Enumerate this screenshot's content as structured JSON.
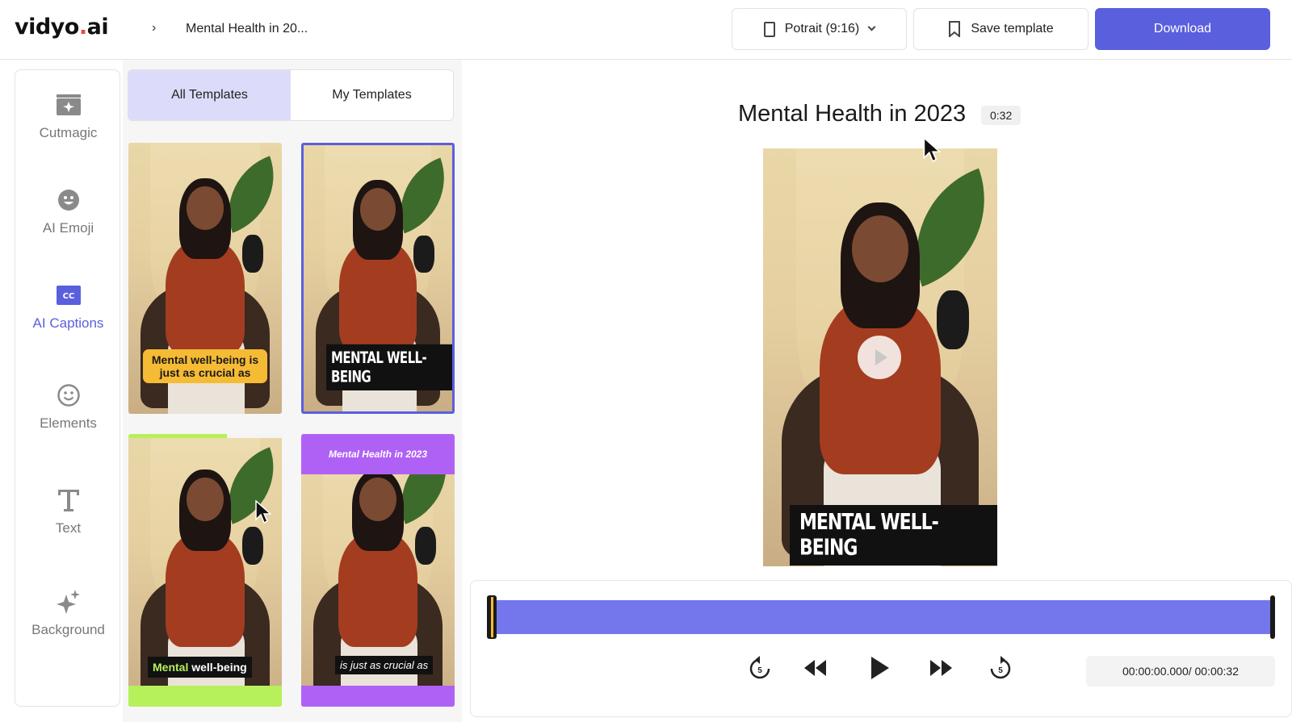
{
  "header": {
    "logo_main": "vidyo",
    "logo_dot": ".",
    "logo_tld": "ai",
    "breadcrumb_sep": "›",
    "project_title": "Mental Health in 20...",
    "aspect_label": "Potrait (9:16)",
    "save_template_label": "Save template",
    "download_label": "Download"
  },
  "sidebar": {
    "items": [
      {
        "label": "Cutmagic",
        "icon": "cutmagic-icon"
      },
      {
        "label": "AI Emoji",
        "icon": "emoji-icon"
      },
      {
        "label": "AI Captions",
        "icon": "captions-icon",
        "active": true
      },
      {
        "label": "Elements",
        "icon": "smiley-icon"
      },
      {
        "label": "Text",
        "icon": "text-icon"
      },
      {
        "label": "Background",
        "icon": "sparkle-icon"
      }
    ]
  },
  "templates": {
    "tabs": [
      {
        "label": "All Templates",
        "active": true
      },
      {
        "label": "My Templates",
        "active": false
      }
    ],
    "items": [
      {
        "caption": "Mental well-being is just as crucial as"
      },
      {
        "caption": "MENTAL WELL-BEING",
        "selected": true
      },
      {
        "caption_highlight": "Mental",
        "caption_rest": " well-being"
      },
      {
        "top_title": "Mental Health in 2023",
        "caption": "is just as crucial as"
      }
    ]
  },
  "preview": {
    "title": "Mental Health in 2023",
    "duration": "0:32",
    "caption": "MENTAL WELL-BEING"
  },
  "timeline": {
    "time_display": "00:00:00.000/ 00:00:32",
    "rewind_seconds": "5",
    "forward_seconds": "5"
  },
  "colors": {
    "accent": "#5a5fdd",
    "track": "#7477ec",
    "caption_yellow": "#f6bb34",
    "caption_green": "#b6f05a",
    "caption_purple": "#b061f5"
  }
}
